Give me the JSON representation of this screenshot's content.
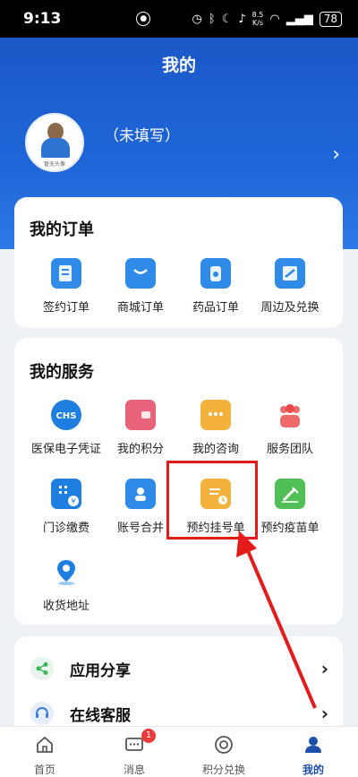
{
  "status_bar": {
    "time": "9:13",
    "speed_value": "8.5",
    "speed_unit": "K/s",
    "battery": "78"
  },
  "header": {
    "title": "我的"
  },
  "profile": {
    "avatar_caption": "暂无头像",
    "name": "（未填写）"
  },
  "orders": {
    "title": "我的订单",
    "items": [
      {
        "label": "签约订单",
        "icon": "contract-order-icon",
        "color": "#2f8ae8"
      },
      {
        "label": "商城订单",
        "icon": "shopping-bag-icon",
        "color": "#2f8ae8"
      },
      {
        "label": "药品订单",
        "icon": "medicine-icon",
        "color": "#2f8ae8"
      },
      {
        "label": "周边及兑换",
        "icon": "exchange-icon",
        "color": "#2f8ae8"
      }
    ]
  },
  "services": {
    "title": "我的服务",
    "items": [
      {
        "label": "医保电子凭证",
        "icon": "chs-insurance-icon",
        "color": "#1f7fe0"
      },
      {
        "label": "我的积分",
        "icon": "wallet-icon",
        "color": "#e8627a"
      },
      {
        "label": "我的咨询",
        "icon": "chat-icon",
        "color": "#f3b23c"
      },
      {
        "label": "服务团队",
        "icon": "team-icon",
        "color": "#ef6a6a"
      },
      {
        "label": "门诊缴费",
        "icon": "payment-icon",
        "color": "#1f7fe0"
      },
      {
        "label": "账号合并",
        "icon": "account-merge-icon",
        "color": "#2f8ae8"
      },
      {
        "label": "预约挂号单",
        "icon": "appointment-icon",
        "color": "#f3b23c"
      },
      {
        "label": "预约疫苗单",
        "icon": "vaccine-icon",
        "color": "#4fbf56"
      },
      {
        "label": "收货地址",
        "icon": "location-icon",
        "color": "#1f7fe0"
      }
    ]
  },
  "list": [
    {
      "label": "应用分享",
      "icon": "share-icon"
    },
    {
      "label": "在线客服",
      "icon": "headset-icon"
    }
  ],
  "tabbar": {
    "tabs": [
      {
        "label": "首页",
        "icon": "home-icon"
      },
      {
        "label": "消息",
        "icon": "message-icon",
        "badge": "1"
      },
      {
        "label": "积分兑换",
        "icon": "points-exchange-icon"
      },
      {
        "label": "我的",
        "icon": "profile-icon"
      }
    ]
  },
  "annotation": {
    "color": "#e31b1b"
  }
}
